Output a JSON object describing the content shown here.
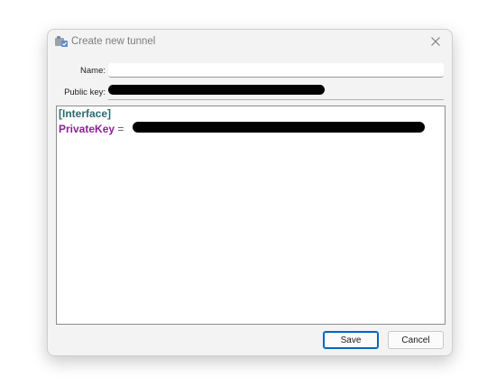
{
  "window": {
    "title": "Create new tunnel",
    "icon": "tunnel-app-icon",
    "close_icon": "close-icon"
  },
  "form": {
    "name_label": "Name:",
    "name_value": "",
    "public_key_label": "Public key:",
    "public_key_value": "[redacted]"
  },
  "editor": {
    "section_header": "[Interface]",
    "private_key_label": "PrivateKey",
    "private_key_separator": " = ",
    "private_key_value": "[redacted]",
    "colors": {
      "section": "#2a6a72",
      "key": "#8a2396"
    }
  },
  "buttons": {
    "save_label": "Save",
    "cancel_label": "Cancel"
  },
  "colors": {
    "accent": "#0067c0",
    "dialog_bg": "#f3f3f3"
  }
}
